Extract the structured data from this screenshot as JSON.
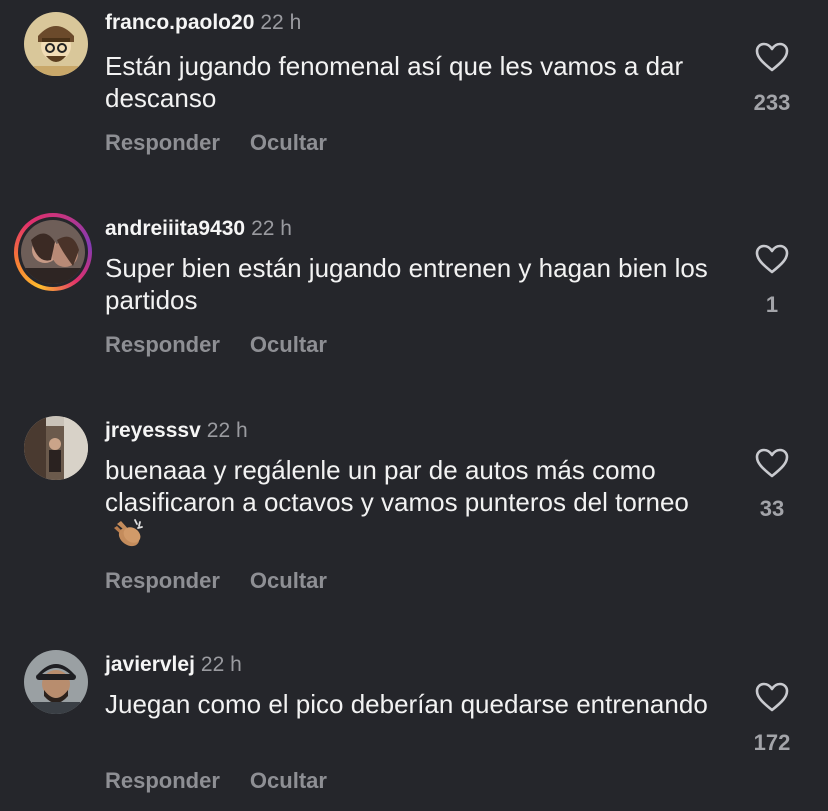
{
  "actions": {
    "reply_label": "Responder",
    "hide_label": "Ocultar"
  },
  "colors": {
    "background": "#25262b",
    "muted": "#8e8f94",
    "story_ring": "#e1306c"
  },
  "comments": [
    {
      "username": "franco.paolo20",
      "time": "22 h",
      "text": "Están jugando fenomenal así que les vamos a dar descanso",
      "likes": "233"
    },
    {
      "username": "andreiiita9430",
      "time": "22 h",
      "text": "Super bien están jugando entrenen y hagan bien los partidos",
      "likes": "1"
    },
    {
      "username": "jreyesssv",
      "time": "22 h",
      "text": "buenaaa y regálenle un par de autos más como clasificaron a octavos y vamos punteros del torneo",
      "likes": "33",
      "emoji": "clapping-hands-icon"
    },
    {
      "username": "javiervlej",
      "time": "22 h",
      "text": "Juegan como el pico  deberían quedarse entrenando",
      "likes": "172"
    }
  ]
}
